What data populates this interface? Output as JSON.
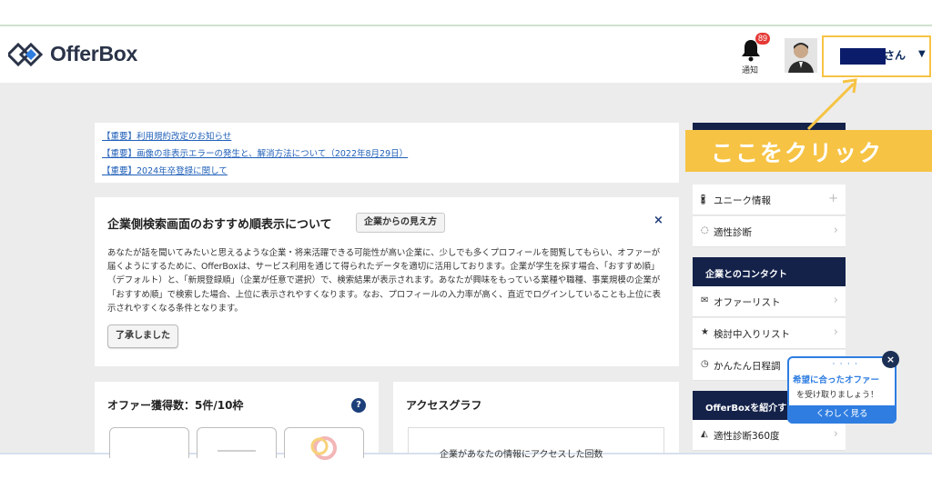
{
  "header": {
    "logo_text": "OfferBox",
    "notification_label": "通知",
    "notification_count": "89",
    "user_suffix": "さん",
    "user_caret": "▼"
  },
  "notices": [
    "【重要】利用規約改定のお知らせ",
    "【重要】画像の非表示エラーの発生と、解消方法について（2022年8月29日）",
    "【重要】2024年卒登録に関して"
  ],
  "recommend": {
    "title": "企業側検索画面のおすすめ順表示について",
    "view_button": "企業からの見え方",
    "close": "×",
    "body": "あなたが話を聞いてみたいと思えるような企業・将来活躍できる可能性が高い企業に、少しでも多くプロフィールを閲覧してもらい、オファーが届くようにするために、OfferBoxは、サービス利用を通じて得られたデータを適切に活用しております。企業が学生を探す場合、「おすすめ順」（デフォルト）と、「新規登録順」（企業が任意で選択）で、検索結果が表示されます。あなたが興味をもっている業種や職種、事業規模の企業が「おすすめ順」で検索した場合、上位に表示されやすくなります。なお、プロフィールの入力率が高く、直近でログインしていることも上位に表示されやすくなる条件となります。",
    "ok_button": "了承しました"
  },
  "offers": {
    "title": "オファー獲得数：5件/10枠",
    "help": "?"
  },
  "access": {
    "title": "アクセスグラフ",
    "text": "企業があなたの情報にアクセスした回数"
  },
  "sidebar": {
    "items_top": [
      {
        "icon": "🖁",
        "label": "ユニーク情報",
        "right": "+"
      },
      {
        "icon": "◌",
        "label": "適性診断",
        "right": "›"
      }
    ],
    "section_contact": "企業とのコンタクト",
    "items_contact": [
      {
        "icon": "✉",
        "label": "オファーリスト",
        "right": "›"
      },
      {
        "icon": "★",
        "label": "検討中入りリスト",
        "right": "›"
      },
      {
        "icon": "◷",
        "label": "かんたん日程調",
        "right": ""
      }
    ],
    "section_intro": "OfferBoxを紹介す",
    "items_intro": [
      {
        "icon": "◭",
        "label": "適性診断360度",
        "right": "›"
      }
    ]
  },
  "callout": {
    "text": "ここをクリック"
  },
  "bubble": {
    "line1": "希望に合ったオファー",
    "line2": "を受け取りましょう！",
    "button": "くわしく見る",
    "close": "×"
  },
  "colors": {
    "navy": "#14224a",
    "accent_yellow": "#f6c344",
    "link_blue": "#1f5fb8",
    "bubble_blue": "#2f7de1",
    "badge_red": "#e53935"
  }
}
